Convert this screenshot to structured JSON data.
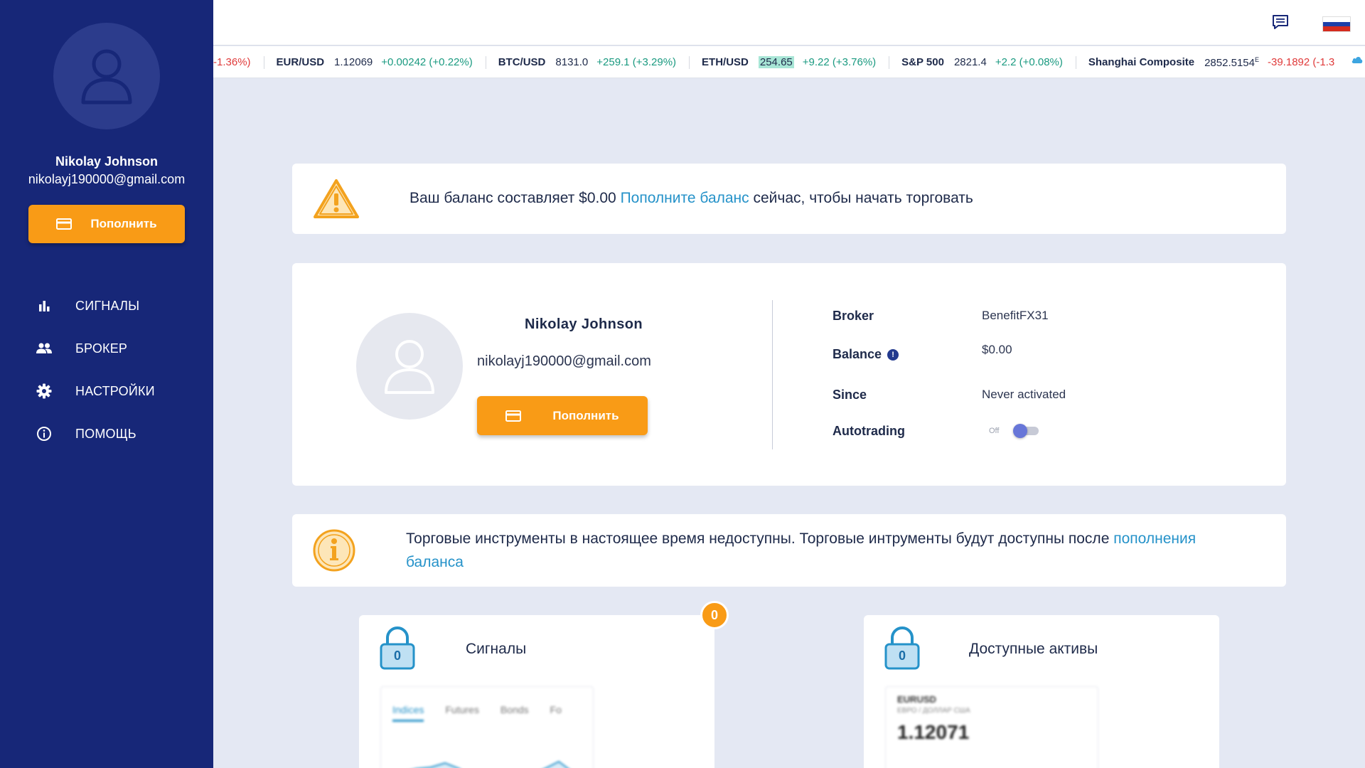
{
  "sidebar": {
    "user_name": "Nikolay  Johnson",
    "user_email": "nikolayj190000@gmail.com",
    "topup_label": "Пополнить",
    "nav": [
      {
        "label": "СИГНАЛЫ",
        "icon": "bar-chart-icon"
      },
      {
        "label": "БРОКЕР",
        "icon": "people-icon"
      },
      {
        "label": "НАСТРОЙКИ",
        "icon": "gear-icon"
      },
      {
        "label": "ПОМОЩЬ",
        "icon": "info-icon"
      }
    ]
  },
  "topbar": {
    "chat_icon": "chat-icon",
    "language_flag": "russian-flag",
    "flag_colors": [
      "#ffffff",
      "#1c3fa8",
      "#d52b1e"
    ]
  },
  "ticker": {
    "first_change": "-1.36%)",
    "items": [
      {
        "symbol": "EUR/USD",
        "price": "1.12069",
        "change": "+0.00242 (+0.22%)",
        "direction": "up"
      },
      {
        "symbol": "BTC/USD",
        "price": "8131.0",
        "change": "+259.1 (+3.29%)",
        "direction": "up"
      },
      {
        "symbol": "ETH/USD",
        "price": "254.65",
        "change": "+9.22 (+3.76%)",
        "direction": "up"
      },
      {
        "symbol": "S&P 500",
        "price": "2821.4",
        "change": "+2.2 (+0.08%)",
        "direction": "up"
      },
      {
        "symbol": "Shanghai Composite",
        "price": "2852.5154",
        "price_sup": "E",
        "change": "-39.1892 (-1.3",
        "direction": "down"
      }
    ]
  },
  "balance_warning": {
    "text_before": "Ваш баланс составляет $0.00 ",
    "link": "Пополните баланс",
    "text_after": " сейчас, чтобы начать торговать"
  },
  "profile": {
    "name": "Nikolay  Johnson",
    "email": "nikolayj190000@gmail.com",
    "topup_label": "Пополнить",
    "broker_label": "Broker",
    "broker_value": "BenefitFX31",
    "balance_label": "Balance",
    "balance_value": "$0.00",
    "since_label": "Since",
    "since_value": "Never activated",
    "autotrading_label": "Autotrading",
    "autotrading_state": "Off"
  },
  "instruments_notice": {
    "text": "Торговые инструменты в настоящее время недоступны. Торговые интрументы будут доступны после ",
    "link": "пополнения баланса"
  },
  "features": {
    "signals": {
      "title": "Сигналы",
      "lock_count": "0",
      "badge": "0",
      "tabs": [
        "Indices",
        "Futures",
        "Bonds",
        "Fo"
      ]
    },
    "assets": {
      "title": "Доступные активы",
      "lock_count": "0",
      "symbol": "EURUSD",
      "subtitle": "ЕВРО / ДОЛЛАР США",
      "price": "1.12071"
    }
  },
  "colors": {
    "sidebar": "#172778",
    "accent_orange": "#f99b16",
    "link_blue": "#2592c9",
    "positive": "#1a9a80",
    "negative": "#e03a3a"
  }
}
